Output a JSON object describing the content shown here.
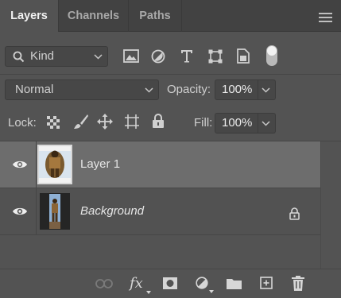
{
  "tabs": [
    {
      "label": "Layers",
      "active": true
    },
    {
      "label": "Channels",
      "active": false
    },
    {
      "label": "Paths",
      "active": false
    }
  ],
  "filter": {
    "kind_label": "Kind",
    "icons": [
      "pixel-filter-icon",
      "adjustment-filter-icon",
      "type-filter-icon",
      "shape-filter-icon",
      "smart-object-filter-icon",
      "filter-toggle-switch"
    ]
  },
  "blend": {
    "mode": "Normal",
    "opacity_label": "Opacity:",
    "opacity_value": "100%"
  },
  "lock": {
    "label": "Lock:",
    "fill_label": "Fill:",
    "fill_value": "100%"
  },
  "layers": [
    {
      "name": "Layer 1",
      "selected": true,
      "visible": true,
      "locked": false,
      "italic": false
    },
    {
      "name": "Background",
      "selected": false,
      "visible": true,
      "locked": true,
      "italic": true
    }
  ],
  "bottom_tools": [
    "link-layers-icon",
    "fx-icon",
    "add-mask-icon",
    "adjustment-layer-icon",
    "new-group-icon",
    "new-layer-icon",
    "delete-layer-icon"
  ],
  "bottom": {
    "fx_label": "fx"
  },
  "colors": {
    "panel_bg": "#535353",
    "tabbar_bg": "#424242",
    "field_bg": "#474747",
    "selected_row": "#6d6d6d",
    "text": "#d6d6d6"
  }
}
